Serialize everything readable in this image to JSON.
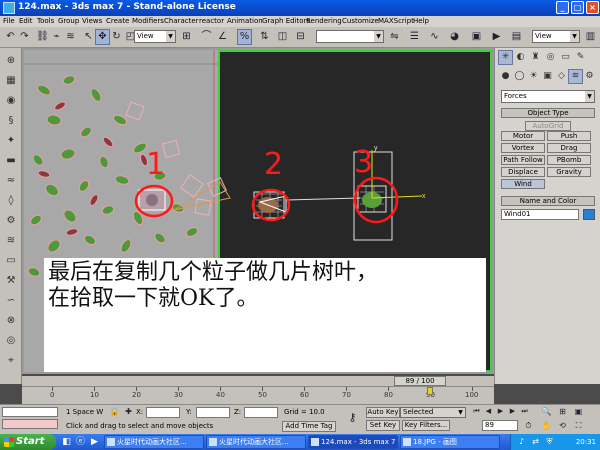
{
  "titlebar": {
    "title": "124.max - 3ds max 7 - Stand-alone License",
    "min": "_",
    "max": "□",
    "close": "×"
  },
  "menu": [
    "File",
    "Edit",
    "Tools",
    "Group",
    "Views",
    "Create",
    "Modifiers",
    "Character",
    "reactor",
    "Animation",
    "Graph Editors",
    "Rendering",
    "Customize",
    "MAXScript",
    "Help"
  ],
  "toolbar": {
    "coord_system": "View",
    "view_dropdown": "View"
  },
  "viewport": {
    "annotations": [
      "1",
      "2",
      "3"
    ],
    "caption_lines": [
      "最后在复制几个粒子做几片树叶，",
      "在拾取一下就OK了。"
    ],
    "gizmo_axes": [
      "y",
      "x"
    ]
  },
  "command_panel": {
    "category": "Forces",
    "object_type_header": "Object Type",
    "autogrid": "AutoGrid",
    "buttons": [
      "Motor",
      "Push",
      "Vortex",
      "Drag",
      "Path Follow",
      "PBomb",
      "Displace",
      "Gravity",
      "Wind"
    ],
    "name_color_header": "Name and Color",
    "name_value": "Wind01",
    "object_color": "#2a7fd4"
  },
  "timeslider": {
    "frame": "89 / 100"
  },
  "trackbar": {
    "ticks": [
      "0",
      "10",
      "20",
      "30",
      "40",
      "50",
      "60",
      "70",
      "80",
      "90",
      "100"
    ]
  },
  "status": {
    "selection": "1 Space W",
    "x_label": "X:",
    "y_label": "Y:",
    "z_label": "Z:",
    "grid": "Grid = 10.0",
    "auto_key": "Auto Key",
    "selected": "Selected",
    "prompt": "Click and drag to select and move objects",
    "add_time_tag": "Add Time Tag",
    "set_key": "Set Key",
    "key_filters": "Key Filters...",
    "frame_field": "89"
  },
  "taskbar": {
    "start": "Start",
    "tasks": [
      "火星时代动画大社区...",
      "火星时代动画大社区...",
      "124.max - 3ds max 7 ...",
      "18.JPG - 画图"
    ],
    "clock": "20:31"
  }
}
